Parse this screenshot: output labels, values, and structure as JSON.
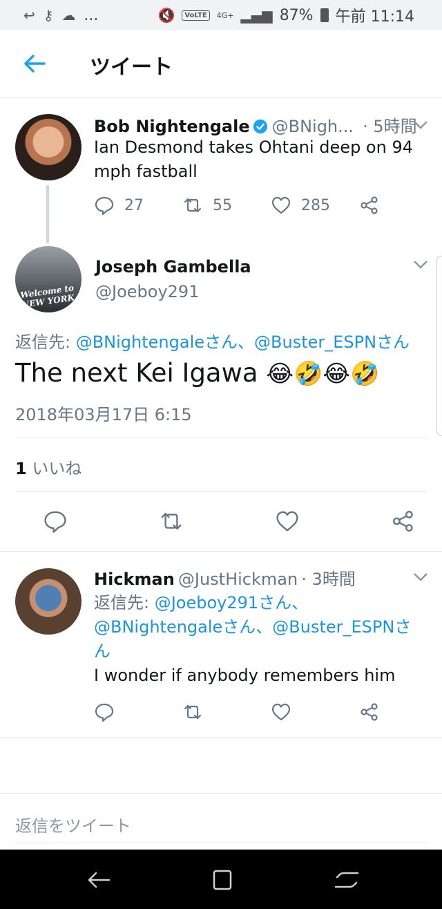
{
  "status_bar": {
    "left_icons": [
      "back-arrow-icon",
      "key-icon",
      "weather-icon"
    ],
    "more": "...",
    "volte": "VoLTE",
    "network": "4G+",
    "battery": "87%",
    "time": "午前 11:14"
  },
  "header": {
    "title": "ツイート"
  },
  "tweets": [
    {
      "name": "Bob Nightengale",
      "handle": "@BNigh...",
      "time": "· 5時間",
      "text_line1": "Ian Desmond takes Ohtani deep on 94",
      "text_line2": "mph fastball",
      "replies": "27",
      "retweets": "55",
      "likes": "285"
    }
  ],
  "focused": {
    "name": "Joseph Gambella",
    "handle": "@Joeboy291",
    "avatar_text": "Welcome to NEW YORK",
    "reply_prefix": "返信先: ",
    "reply_to_1": "@BNightengaleさん",
    "reply_sep": "、",
    "reply_to_2": "@Buster_ESPNさん",
    "text": "The next Kei Igawa",
    "emojis": [
      "😂",
      "🤣",
      "😂",
      "🤣"
    ],
    "datetime": "2018年03月17日 6:15",
    "likes_count": "1",
    "likes_label": "いいね"
  },
  "reply": {
    "name": "Hickman",
    "handle": "@JustHickman",
    "time": "· 3時間",
    "reply_prefix": "返信先: ",
    "reply_to_1": "@Joeboy291さん、",
    "reply_to_2": "@BNightengaleさん、",
    "reply_to_3": "@Buster_ESPNさ",
    "reply_to_4": "ん",
    "text": "I wonder if anybody remembers him"
  },
  "compose": {
    "placeholder": "返信をツイート"
  },
  "colors": {
    "link": "#1b95e0",
    "secondary": "#657786",
    "primary_text": "#14171a"
  }
}
